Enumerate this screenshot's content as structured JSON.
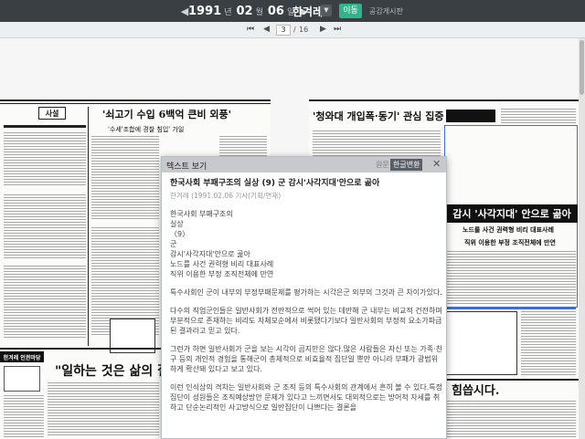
{
  "topbar": {
    "prev_arrow": "◀",
    "year": "1991",
    "year_unit": "년",
    "month": "02",
    "month_unit": "월",
    "day": "06",
    "day_unit": "일",
    "next_arrow": "▶",
    "newspaper": "한겨레",
    "newspaper_dropdown": "▼",
    "go_button": "이동",
    "board_link": "공감게시판"
  },
  "pagebar": {
    "first": "⏮",
    "prev": "◀",
    "current_page": "3",
    "separator": "/",
    "total_pages": "16",
    "next": "▶",
    "last": "⏭"
  },
  "scan": {
    "left_page": {
      "editorial_tag": "사설",
      "headline": "'쇠고기 수입 6백억 큰비 외풍'",
      "sub_headline": "'수세'조합에 경찰 침입' 가일",
      "banner": "\"일하는 것은 삶의 질",
      "section_label": "한겨레 인권마당"
    },
    "right_page": {
      "headline": "'청와대 개입폭·동기' 관심 집중",
      "black_headline": "감시 '사각지대' 안으로 곪아",
      "sub1": "노드를 사건 권력형 비리 대표사례",
      "sub2": "직위 이용한 부정 조직전체에 만연",
      "bottom_headline": "힘씁시다."
    }
  },
  "modal": {
    "title": "텍스트 보기",
    "tab_original": "원문",
    "tab_converted": "한글변환",
    "close": "✕",
    "article_title": "한국사회 부패구조의 실상 (9) 군 감시'사각지대'안으로 곪아",
    "article_meta": "한겨레 (1991.02.06 기사(기획/연재)",
    "lines": [
      "한국사회 부패구조의",
      "실상",
      "〈9〉",
      "군",
      "감시'사각지대'안으로 곪아",
      "노드를 사건 권력형 비리 대표사례",
      "직위 이용한 부정 조직전체에 만연"
    ],
    "paragraphs": [
      "특수사회인 군이 내부의 부정부패문제를 평가하는 시각은군 외부의 그것과 큰 차이가있다.",
      "다수의 직업군인들은 일반사회가 전반적으로 썩어 있는 데반해 군 내부는 비교적 건전하며 부분적으로 존재하는 비리도 자체모순에서 비롯됐다기보다 일반사회의 부정적 요소가파급된 결과라고 믿고 있다.",
      "그런가 하면 일반사회가 군을 보는 시각이 곱지만은 않다.많은 사람들은 자신 또는 가족·친구 등의 개인적 경험을 통해군이 총체적으로 비효율적 집단일 뿐만 아니라 부패가 광범위하게 확산돼 있다고 보고 있다.",
      "이런 인식상의 격차는 일반사회와 군 조직 등의 특수사회의 관계에서 흔히 볼 수 있다.특정집단이 성원들은 조직예상방안 문제가 있다고 느끼면서도 대외적으로는 방어적 자세를 취하고 단순논리적인 사고방식으로 일반집단이 나쁘다는 결론을"
    ]
  },
  "colors": {
    "topbar_bg": "#3a3f44",
    "go_button": "#2fb38a",
    "modal_header": "#c7c9cc",
    "selection_blue": "#3d6fd1"
  }
}
